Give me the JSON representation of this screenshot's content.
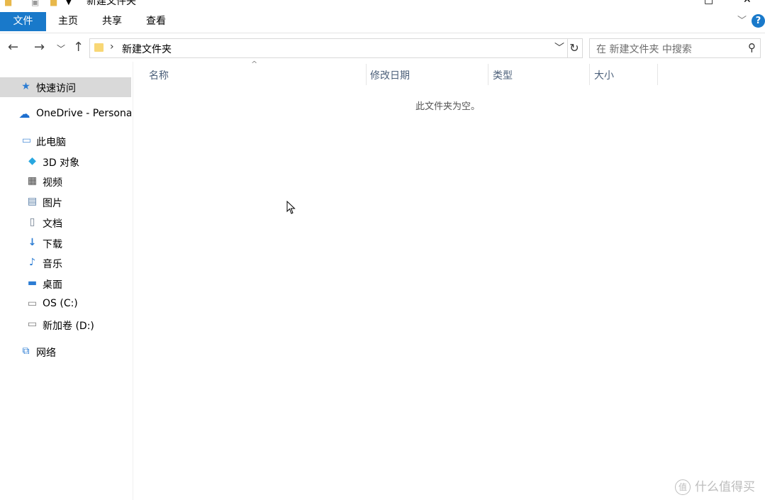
{
  "window": {
    "title": "新建文件夹"
  },
  "ribbon": {
    "tabs": [
      {
        "label": "文件"
      },
      {
        "label": "主页"
      },
      {
        "label": "共享"
      },
      {
        "label": "查看"
      }
    ],
    "help_label": "?"
  },
  "address": {
    "path": "新建文件夹",
    "search_placeholder": "在 新建文件夹 中搜索"
  },
  "sidebar": {
    "items": [
      {
        "label": "快速访问",
        "icon": "star-icon"
      },
      {
        "label": "OneDrive - Persona",
        "icon": "cloud-icon"
      },
      {
        "label": "此电脑",
        "icon": "computer-icon"
      },
      {
        "label": "3D 对象",
        "icon": "cube-icon"
      },
      {
        "label": "视频",
        "icon": "video-icon"
      },
      {
        "label": "图片",
        "icon": "picture-icon"
      },
      {
        "label": "文档",
        "icon": "document-icon"
      },
      {
        "label": "下载",
        "icon": "download-icon"
      },
      {
        "label": "音乐",
        "icon": "music-icon"
      },
      {
        "label": "桌面",
        "icon": "desktop-icon"
      },
      {
        "label": "OS (C:)",
        "icon": "drive-c-icon"
      },
      {
        "label": "新加卷 (D:)",
        "icon": "drive-d-icon"
      },
      {
        "label": "网络",
        "icon": "network-icon"
      }
    ]
  },
  "columns": {
    "name": "名称",
    "modified": "修改日期",
    "type": "类型",
    "size": "大小"
  },
  "content": {
    "empty_message": "此文件夹为空。"
  },
  "watermark": {
    "text": "什么值得买",
    "badge": "值"
  },
  "colors": {
    "accent": "#1979ca",
    "selected": "#d9d9d9",
    "column_header": "#4c607a"
  }
}
